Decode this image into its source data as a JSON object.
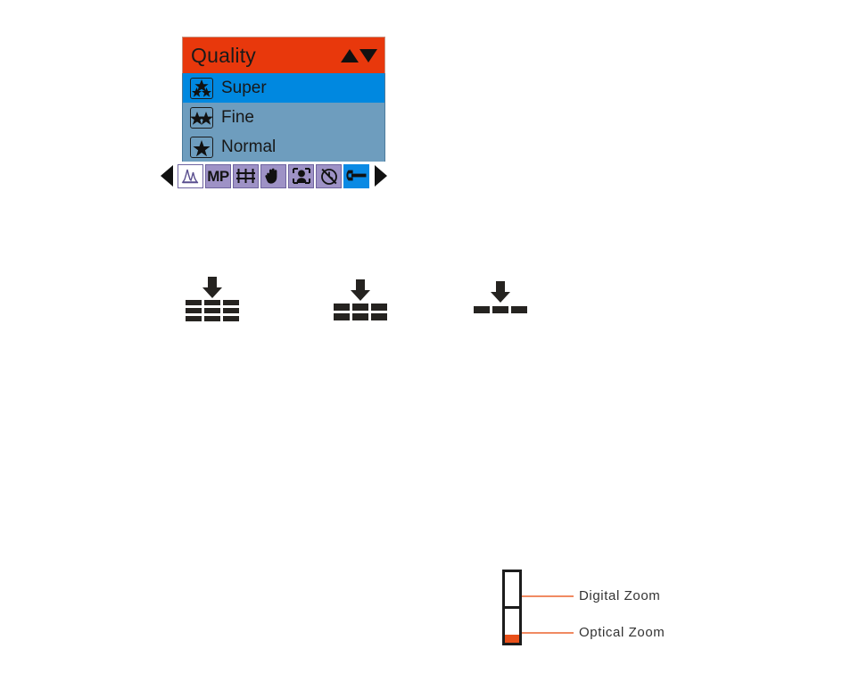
{
  "menu": {
    "title": "Quality",
    "scroll_up_icon": "triangle-up-icon",
    "scroll_down_icon": "triangle-down-icon",
    "items": [
      {
        "label": "Super",
        "stars": 3,
        "selected": true,
        "icon": "three-star-icon"
      },
      {
        "label": "Fine",
        "stars": 2,
        "selected": false,
        "icon": "two-star-icon"
      },
      {
        "label": "Normal",
        "stars": 1,
        "selected": false,
        "icon": "one-star-icon"
      }
    ],
    "colors": {
      "title_bar": "#e8380c",
      "selected_row": "#0088e0",
      "list_background": "#6e9dbe",
      "toolbar_icon": "#9e92c6",
      "toolbar_active": "#0a8ae4"
    }
  },
  "toolbar": {
    "prev_arrow": "arrow-left-icon",
    "next_arrow": "arrow-right-icon",
    "items": [
      {
        "name": "histogram-icon",
        "label": "",
        "state": "current"
      },
      {
        "name": "megapixel-icon",
        "label": "MP",
        "state": "normal"
      },
      {
        "name": "image-size-icon",
        "label": "",
        "state": "normal"
      },
      {
        "name": "hand-stabilizer-icon",
        "label": "",
        "state": "normal"
      },
      {
        "name": "portrait-scene-icon",
        "label": "",
        "state": "normal"
      },
      {
        "name": "self-timer-off-icon",
        "label": "",
        "state": "normal"
      },
      {
        "name": "wrench-setup-icon",
        "label": "",
        "state": "selected"
      }
    ]
  },
  "compression_icons": [
    {
      "name": "compression-super-icon",
      "rows": 3,
      "cols": 3,
      "arrow": "arrow-down-icon"
    },
    {
      "name": "compression-fine-icon",
      "rows": 2,
      "cols": 3,
      "arrow": "arrow-down-icon"
    },
    {
      "name": "compression-normal-icon",
      "rows": 1,
      "cols": 3,
      "arrow": "arrow-down-icon"
    }
  ],
  "zoom_diagram": {
    "name": "zoom-range-bar",
    "labels": {
      "digital": "Digital Zoom",
      "optical": "Optical Zoom"
    },
    "marker_color": "#e8501a",
    "leader_color": "#f08a62"
  }
}
